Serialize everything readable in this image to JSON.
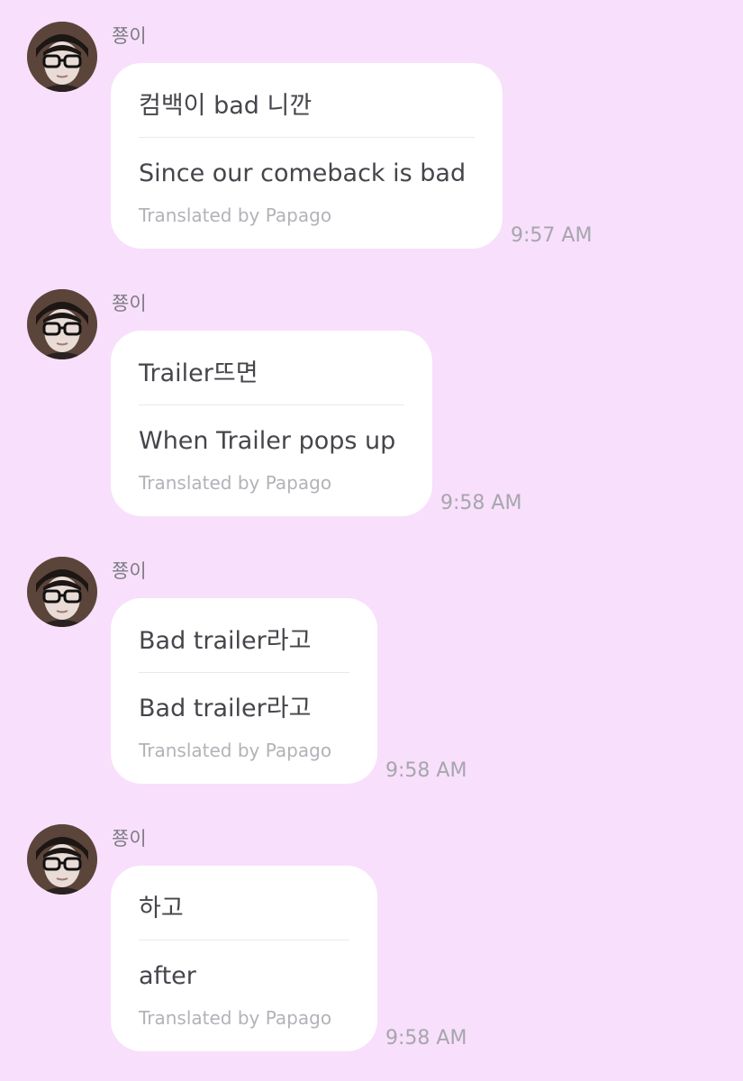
{
  "chat": {
    "messages": [
      {
        "sender": "쭁이",
        "avatar": "avatar-icon",
        "original": "컴백이 bad 니깐",
        "translation": "Since our comeback is bad",
        "credit": "Translated by Papago",
        "time": "9:57 AM"
      },
      {
        "sender": "쭁이",
        "avatar": "avatar-icon",
        "original": "Trailer뜨면",
        "translation": "When Trailer pops up",
        "credit": "Translated by Papago",
        "time": "9:58 AM"
      },
      {
        "sender": "쭁이",
        "avatar": "avatar-icon",
        "original": "Bad trailer라고",
        "translation": "Bad trailer라고",
        "credit": "Translated by Papago",
        "time": "9:58 AM"
      },
      {
        "sender": "쭁이",
        "avatar": "avatar-icon",
        "original": "하고",
        "translation": "after",
        "credit": "Translated by Papago",
        "time": "9:58 AM"
      }
    ]
  },
  "colors": {
    "background": "#f8dffb",
    "bubble": "#ffffff",
    "text": "#45454b",
    "muted": "#b2b2b8",
    "timestamp": "#a6a6ad"
  }
}
